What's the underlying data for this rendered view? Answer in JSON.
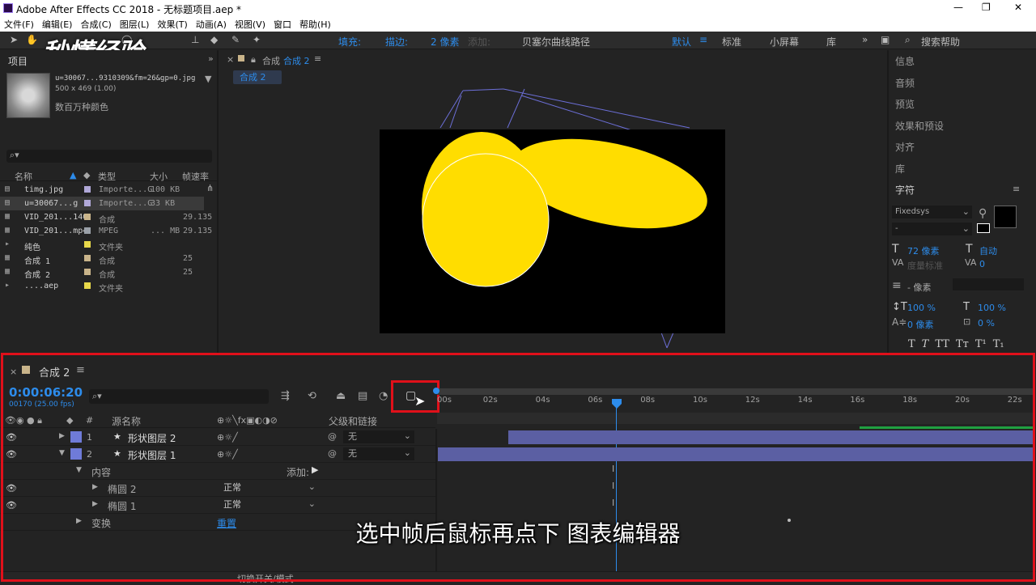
{
  "window": {
    "title": "Adobe After Effects CC 2018 - 无标题项目.aep *",
    "min": "—",
    "max": "❐",
    "close": "✕"
  },
  "menu": [
    "文件(F)",
    "编辑(E)",
    "合成(C)",
    "图层(L)",
    "效果(T)",
    "动画(A)",
    "视图(V)",
    "窗口",
    "帮助(H)"
  ],
  "toolbar": {
    "fill_label": "填充:",
    "stroke_label": "描边:",
    "stroke_px": "2 像素",
    "add_label": "添加:",
    "bezier_label": "贝塞尔曲线路径",
    "workspaces": [
      "默认",
      "标准",
      "小屏幕",
      "库"
    ],
    "search_placeholder": "搜索帮助"
  },
  "watermark": "秒懂经验",
  "project": {
    "tab": "项目",
    "file_name": "u=30067...9310309&fm=26&gp=0.jpg",
    "file_dims": "500 x 469 (1.00)",
    "file_colors": "数百万种颜色",
    "columns": {
      "name": "名称",
      "type": "类型",
      "size": "大小",
      "fps": "帧速率"
    },
    "items": [
      {
        "name": "timg.jpg",
        "type": "Importe...G",
        "size": "100 KB",
        "fps": "",
        "color": "#b0a8d8"
      },
      {
        "name": "u=30067...g",
        "type": "Importe...G",
        "size": "33 KB",
        "fps": "",
        "color": "#b0a8d8"
      },
      {
        "name": "VID_201...140",
        "type": "合成",
        "size": "",
        "fps": "29.135",
        "color": "#c9b48a"
      },
      {
        "name": "VID_201...mp4",
        "type": "MPEG",
        "size": "... MB",
        "fps": "29.135",
        "color": "#9aa0a8"
      },
      {
        "name": "纯色",
        "type": "文件夹",
        "size": "",
        "fps": "",
        "color": "#e8d84a"
      },
      {
        "name": "合成 1",
        "type": "合成",
        "size": "",
        "fps": "25",
        "color": "#c9b48a"
      },
      {
        "name": "合成 2",
        "type": "合成",
        "size": "",
        "fps": "25",
        "color": "#c9b48a"
      },
      {
        "name": "....aep",
        "type": "文件夹",
        "size": "",
        "fps": "",
        "color": "#e8d84a"
      }
    ]
  },
  "comp_viewer": {
    "tab_prefix": "合成",
    "tab_name": "合成 2",
    "breadcrumb": "合成 2"
  },
  "right_panel": {
    "items": [
      "信息",
      "音频",
      "预览",
      "效果和预设",
      "对齐",
      "库",
      "字符"
    ],
    "font": "Fixedsys",
    "font_style": "-",
    "size": "72 像素",
    "leading": "自动",
    "kerning": "度量标准",
    "tracking": "0",
    "stroke_px": "- 像素",
    "vscale": "100 %",
    "hscale": "100 %",
    "baseline": "0 像素",
    "tsume": "0 %",
    "styles": [
      "T",
      "T",
      "TT",
      "Tт",
      "T¹",
      "T₁"
    ]
  },
  "timeline": {
    "tab": "合成 2",
    "timecode": "0:00:06:20",
    "frame_info": "00170 (25.00 fps)",
    "ruler": [
      "00s",
      "02s",
      "04s",
      "06s",
      "08s",
      "10s",
      "12s",
      "14s",
      "16s",
      "18s",
      "20s",
      "22s"
    ],
    "columns": {
      "num": "#",
      "source": "源名称",
      "parent": "父级和链接"
    },
    "layers": [
      {
        "num": "1",
        "name": "形状图层 2",
        "parent": "无"
      },
      {
        "num": "2",
        "name": "形状图层 1",
        "parent": "无"
      }
    ],
    "contents_label": "内容",
    "add_label": "添加:",
    "ellipse2": "椭圆 2",
    "ellipse1": "椭圆 1",
    "blend": "正常",
    "transform": "变换",
    "reset": "重置",
    "footer": "切换开关/模式"
  },
  "subtitle": "选中帧后鼠标再点下 图表编辑器",
  "colors": {
    "highlight": "#e0101a",
    "accent": "#2d8ceb",
    "yellow": "#ffdd00",
    "layer_color": "#6f7bd8"
  }
}
